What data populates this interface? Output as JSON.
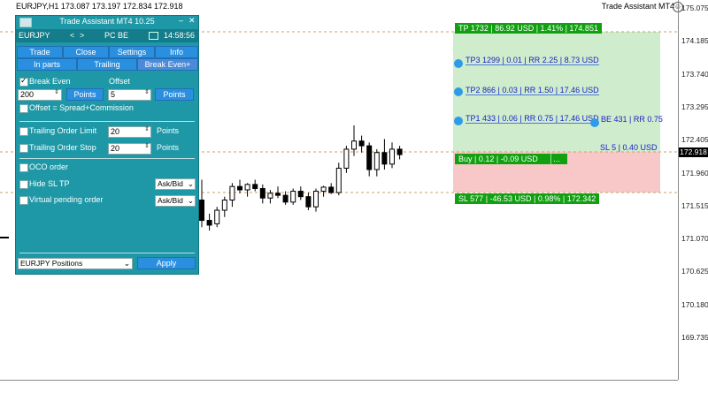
{
  "chart": {
    "header": "EURJPY,H1  173.087 173.197 172.834 172.918",
    "corner_label": "Trade Assistant MT4",
    "price_ticks": [
      "175.075",
      "174.185",
      "173.740",
      "173.295",
      "172.405",
      "171.960",
      "171.515",
      "171.070",
      "170.625",
      "170.180",
      "169.735"
    ],
    "current_price": "172.918",
    "candles": [
      {
        "o": 172.25,
        "h": 172.55,
        "l": 171.85,
        "c": 171.95
      },
      {
        "o": 171.95,
        "h": 172.05,
        "l": 171.8,
        "c": 171.88
      },
      {
        "o": 171.9,
        "h": 172.15,
        "l": 171.85,
        "c": 172.1
      },
      {
        "o": 172.1,
        "h": 172.3,
        "l": 172.0,
        "c": 172.25
      },
      {
        "o": 172.25,
        "h": 172.5,
        "l": 172.15,
        "c": 172.45
      },
      {
        "o": 172.45,
        "h": 172.55,
        "l": 172.35,
        "c": 172.4
      },
      {
        "o": 172.4,
        "h": 172.5,
        "l": 172.3,
        "c": 172.48
      },
      {
        "o": 172.48,
        "h": 172.55,
        "l": 172.38,
        "c": 172.42
      },
      {
        "o": 172.42,
        "h": 172.48,
        "l": 172.2,
        "c": 172.28
      },
      {
        "o": 172.28,
        "h": 172.4,
        "l": 172.2,
        "c": 172.35
      },
      {
        "o": 172.35,
        "h": 172.45,
        "l": 172.28,
        "c": 172.32
      },
      {
        "o": 172.32,
        "h": 172.38,
        "l": 172.18,
        "c": 172.22
      },
      {
        "o": 172.22,
        "h": 172.42,
        "l": 172.18,
        "c": 172.38
      },
      {
        "o": 172.38,
        "h": 172.45,
        "l": 172.25,
        "c": 172.3
      },
      {
        "o": 172.3,
        "h": 172.36,
        "l": 172.1,
        "c": 172.15
      },
      {
        "o": 172.15,
        "h": 172.42,
        "l": 172.08,
        "c": 172.38
      },
      {
        "o": 172.38,
        "h": 172.46,
        "l": 172.3,
        "c": 172.44
      },
      {
        "o": 172.44,
        "h": 172.5,
        "l": 172.34,
        "c": 172.36
      },
      {
        "o": 172.36,
        "h": 172.8,
        "l": 172.32,
        "c": 172.72
      },
      {
        "o": 172.72,
        "h": 173.05,
        "l": 172.65,
        "c": 173.0
      },
      {
        "o": 173.0,
        "h": 173.35,
        "l": 172.9,
        "c": 173.12
      },
      {
        "o": 173.12,
        "h": 173.2,
        "l": 172.95,
        "c": 173.05
      },
      {
        "o": 173.05,
        "h": 173.1,
        "l": 172.6,
        "c": 172.7
      },
      {
        "o": 172.7,
        "h": 173.0,
        "l": 172.6,
        "c": 172.95
      },
      {
        "o": 172.95,
        "h": 173.15,
        "l": 172.7,
        "c": 172.78
      },
      {
        "o": 172.78,
        "h": 173.1,
        "l": 172.72,
        "c": 173.0
      },
      {
        "o": 173.0,
        "h": 173.05,
        "l": 172.85,
        "c": 172.92
      }
    ],
    "ylim": [
      169.6,
      175.2
    ]
  },
  "levels": {
    "tp_label": "TP 1732 | 86.92 USD | 1.41% | 174.851",
    "tp3": "TP3 1299 | 0.01 | RR 2.25 | 8.73 USD",
    "tp2": "TP2 866 | 0.03 | RR 1.50 | 17.46 USD",
    "tp1": "TP1 433 | 0.06 | RR 0.75 | 17.46 USD",
    "be": "BE 431 | RR 0.75",
    "sl_small": "SL 5 | 0.40 USD",
    "buy_label": "Buy | 0.12 | -0.09 USD",
    "buy_extra": "...",
    "sl_label": "SL 577 | -46.53 USD | 0.98% | 172.342"
  },
  "panel": {
    "title": "Trade Assistant MT4 10.25",
    "minimize": "–",
    "close": "✕",
    "symbol": "EURJPY",
    "nav_lt": "<",
    "nav_gt": ">",
    "account": "PC BE",
    "time": "14:58:56",
    "tabs_row1": [
      "Trade",
      "Close",
      "Settings",
      "Info"
    ],
    "tabs_row2": [
      "In parts",
      "Trailing",
      "Break Even+"
    ],
    "break_even_label": "Break Even",
    "offset_label": "Offset",
    "be_value": "200",
    "offset_value": "5",
    "points_btn": "Points",
    "offset_spread": "Offset = Spread+Commission",
    "trail_limit_label": "Trailing Order Limit",
    "trail_limit_value": "20",
    "trail_stop_label": "Trailing Order Stop",
    "trail_stop_value": "20",
    "points_label": "Points",
    "oco_label": "OCO order",
    "hide_sltp_label": "Hide SL TP",
    "hide_sltp_select": "Ask/Bid",
    "virtual_label": "Virtual pending order",
    "virtual_select": "Ask/Bid",
    "positions_select": "EURJPY Positions",
    "apply_btn": "Apply"
  },
  "colors": {
    "panel_bg": "#1e98a6",
    "button_blue": "#2b8fe0",
    "tp_zone": "#cfeccc",
    "sl_zone": "#f8c8c8",
    "label_green": "#10a010",
    "line_text_blue": "#1b22c8"
  }
}
